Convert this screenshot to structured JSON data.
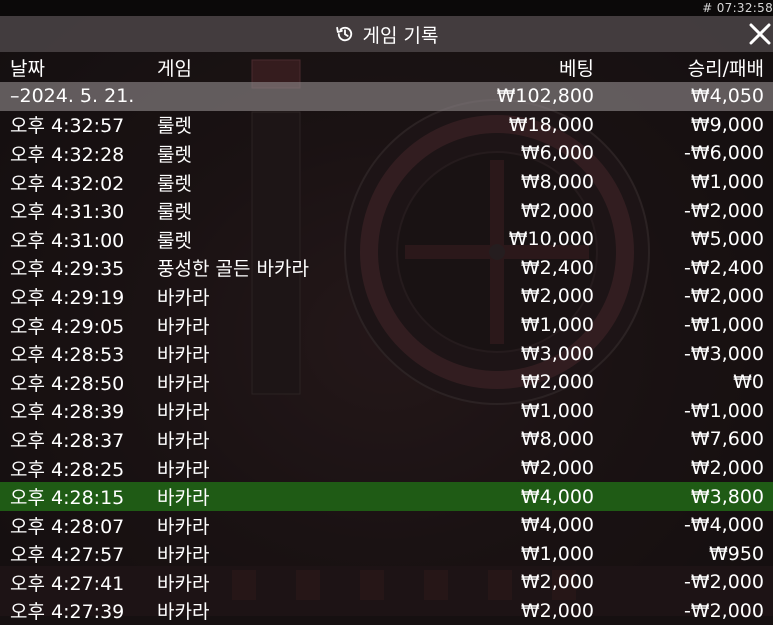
{
  "status_bar": {
    "clock": "# 07:32:58"
  },
  "header": {
    "title": "게임 기록"
  },
  "columns": {
    "date": "날짜",
    "game": "게임",
    "bet": "베팅",
    "win_loss": "승리/패배"
  },
  "summary": {
    "date": "–2024. 5. 21.",
    "bet": "₩102,800",
    "win_loss": "₩4,050"
  },
  "rows": [
    {
      "time": "오후 4:32:57",
      "game": "룰렛",
      "bet": "₩18,000",
      "win_loss": "₩9,000"
    },
    {
      "time": "오후 4:32:28",
      "game": "룰렛",
      "bet": "₩6,000",
      "win_loss": "-₩6,000"
    },
    {
      "time": "오후 4:32:02",
      "game": "룰렛",
      "bet": "₩8,000",
      "win_loss": "₩1,000"
    },
    {
      "time": "오후 4:31:30",
      "game": "룰렛",
      "bet": "₩2,000",
      "win_loss": "-₩2,000"
    },
    {
      "time": "오후 4:31:00",
      "game": "룰렛",
      "bet": "₩10,000",
      "win_loss": "₩5,000"
    },
    {
      "time": "오후 4:29:35",
      "game": "풍성한 골든 바카라",
      "bet": "₩2,400",
      "win_loss": "-₩2,400"
    },
    {
      "time": "오후 4:29:19",
      "game": "바카라",
      "bet": "₩2,000",
      "win_loss": "-₩2,000"
    },
    {
      "time": "오후 4:29:05",
      "game": "바카라",
      "bet": "₩1,000",
      "win_loss": "-₩1,000"
    },
    {
      "time": "오후 4:28:53",
      "game": "바카라",
      "bet": "₩3,000",
      "win_loss": "-₩3,000"
    },
    {
      "time": "오후 4:28:50",
      "game": "바카라",
      "bet": "₩2,000",
      "win_loss": "₩0"
    },
    {
      "time": "오후 4:28:39",
      "game": "바카라",
      "bet": "₩1,000",
      "win_loss": "-₩1,000"
    },
    {
      "time": "오후 4:28:37",
      "game": "바카라",
      "bet": "₩8,000",
      "win_loss": "₩7,600"
    },
    {
      "time": "오후 4:28:25",
      "game": "바카라",
      "bet": "₩2,000",
      "win_loss": "₩2,000"
    },
    {
      "time": "오후 4:28:15",
      "game": "바카라",
      "bet": "₩4,000",
      "win_loss": "₩3,800"
    },
    {
      "time": "오후 4:28:07",
      "game": "바카라",
      "bet": "₩4,000",
      "win_loss": "-₩4,000"
    },
    {
      "time": "오후 4:27:57",
      "game": "바카라",
      "bet": "₩1,000",
      "win_loss": "₩950"
    },
    {
      "time": "오후 4:27:41",
      "game": "바카라",
      "bet": "₩2,000",
      "win_loss": "-₩2,000"
    },
    {
      "time": "오후 4:27:39",
      "game": "바카라",
      "bet": "₩2,000",
      "win_loss": "-₩2,000"
    }
  ],
  "highlight_row_index": 13,
  "colors": {
    "highlight": "#1f5b15",
    "summary": "#6e686a",
    "header": "#464042"
  }
}
